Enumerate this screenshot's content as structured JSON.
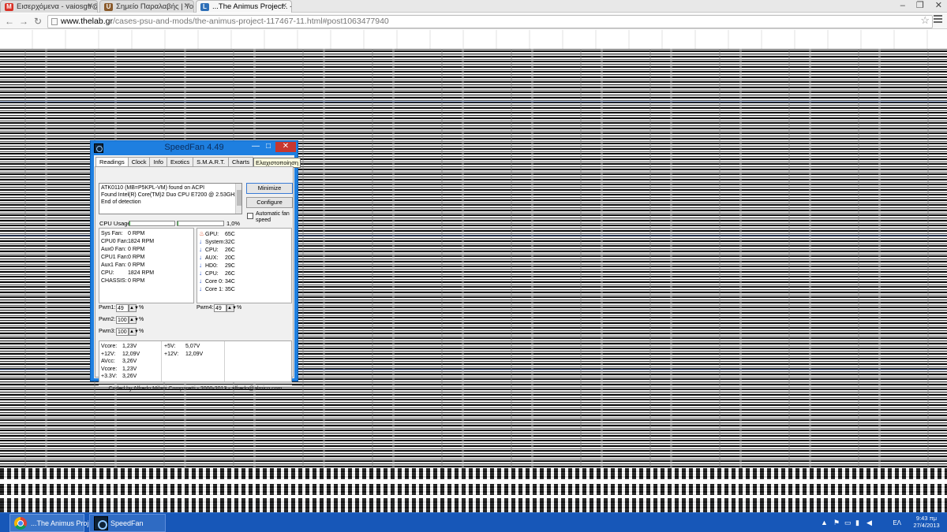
{
  "browser": {
    "tabs": [
      {
        "label": "Εισερχόμενα - vaiosgtr@g",
        "favicon": "gmail-icon",
        "favicon_color": "#d93025",
        "favicon_glyph": "M"
      },
      {
        "label": "Σημείο Παραλαβής | You",
        "favicon": "page-icon",
        "favicon_color": "#8a5a2b",
        "favicon_glyph": "U"
      },
      {
        "label": "...The Animus Project.. - P",
        "favicon": "thelab-icon",
        "favicon_color": "#2e6fb7",
        "favicon_glyph": "L"
      }
    ],
    "active_tab": 2,
    "url_host": "www.thelab.gr",
    "url_path": "/cases-psu-and-mods/the-animus-project-117467-11.html#post1063477940"
  },
  "speedfan": {
    "title": "SpeedFan 4.49",
    "tooltip": "Ελαχιστοποίηση",
    "tabs": [
      "Readings",
      "Clock",
      "Info",
      "Exotics",
      "S.M.A.R.T.",
      "Charts"
    ],
    "active_tab": "Readings",
    "log": [
      "ATK0110 (MB=P5KPL-VM) found on ACPI",
      "Found Intel(R) Core(TM)2 Duo CPU E7200 @ 2.53GHz",
      "End of detection"
    ],
    "minimize_label": "Minimize",
    "configure_label": "Configure",
    "auto_fan_label": "Automatic fan speed",
    "auto_fan_checked": false,
    "cpu_usage_label": "CPU Usage",
    "cpu_usage_value": "1,0%",
    "cpu_usage_fraction": 0.01,
    "fans": [
      {
        "label": "Sys Fan:",
        "value": "0 RPM"
      },
      {
        "label": "CPU0 Fan:",
        "value": "1824 RPM"
      },
      {
        "label": "Aux0 Fan:",
        "value": "0 RPM"
      },
      {
        "label": "CPU1 Fan:",
        "value": "0 RPM"
      },
      {
        "label": "Aux1 Fan:",
        "value": "0 RPM"
      },
      {
        "label": "CPU:",
        "value": "1824 RPM"
      },
      {
        "label": "CHASSIS:",
        "value": "0 RPM"
      }
    ],
    "temps": [
      {
        "label": "GPU:",
        "value": "65C",
        "icon": "flame-icon"
      },
      {
        "label": "System:",
        "value": "32C",
        "icon": "arrow-down-icon"
      },
      {
        "label": "CPU:",
        "value": "26C",
        "icon": "arrow-down-icon"
      },
      {
        "label": "AUX:",
        "value": "20C",
        "icon": "arrow-down-icon"
      },
      {
        "label": "HD0:",
        "value": "29C",
        "icon": "arrow-down-icon"
      },
      {
        "label": "CPU:",
        "value": "26C",
        "icon": "arrow-down-icon"
      },
      {
        "label": "Core 0:",
        "value": "34C",
        "icon": "arrow-down-icon"
      },
      {
        "label": "Core 1:",
        "value": "35C",
        "icon": "arrow-down-icon"
      }
    ],
    "pwm": [
      {
        "label": "Pwm1:",
        "value": "49",
        "unit": "%"
      },
      {
        "label": "Pwm2:",
        "value": "100",
        "unit": "%"
      },
      {
        "label": "Pwm3:",
        "value": "100",
        "unit": "%"
      },
      {
        "label": "Pwm4:",
        "value": "49",
        "unit": "%"
      }
    ],
    "volts_left": [
      {
        "label": "Vcore:",
        "value": "1,23V"
      },
      {
        "label": "+12V:",
        "value": "12,09V"
      },
      {
        "label": "AVcc:",
        "value": "3,26V"
      },
      {
        "label": "Vcore:",
        "value": "1,23V"
      },
      {
        "label": "+3.3V:",
        "value": "3,26V"
      }
    ],
    "volts_right": [
      {
        "label": "+5V:",
        "value": "5,07V"
      },
      {
        "label": "+12V:",
        "value": "12,09V"
      }
    ],
    "footer": "Coded by Alfredo Milani Comparetti - 2000-2013 - alfredo@almico.com"
  },
  "taskbar": {
    "items": [
      {
        "label": "...The Animus Proj...",
        "icon": "chrome-icon"
      },
      {
        "label": "SpeedFan",
        "icon": "speedfan-icon"
      }
    ],
    "language": "ΕΛ",
    "time": "9:43 πμ",
    "date": "27/4/2013"
  }
}
